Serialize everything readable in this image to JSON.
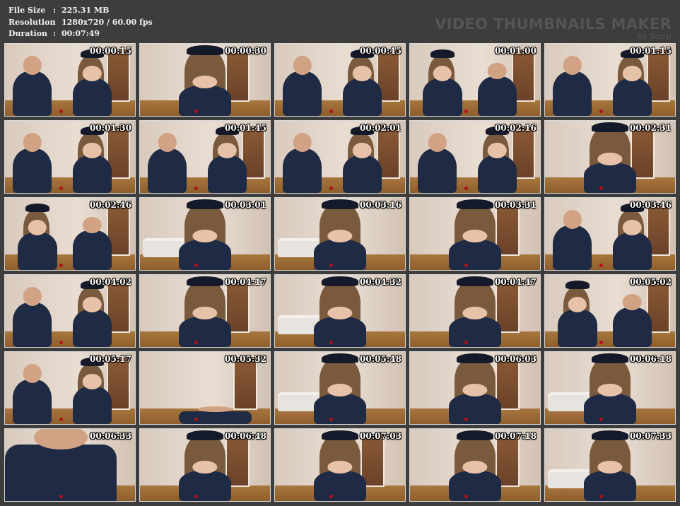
{
  "info": {
    "rows": [
      {
        "label": "File Size",
        "sep": ":",
        "value": "225.31 MB"
      },
      {
        "label": "Resolution",
        "sep": ":",
        "value": "1280x720 / 60.00 fps"
      },
      {
        "label": "Duration",
        "sep": ":",
        "value": "00:07:49"
      }
    ]
  },
  "watermark": {
    "title": "VIDEO THUMBNAILS MAKER",
    "sub": "by Scorp"
  },
  "thumbnails": [
    {
      "time": "00:00:15",
      "scene": "two"
    },
    {
      "time": "00:00:30",
      "scene": "woman-door"
    },
    {
      "time": "00:00:45",
      "scene": "two"
    },
    {
      "time": "00:01:00",
      "scene": "two-bend"
    },
    {
      "time": "00:01:15",
      "scene": "two"
    },
    {
      "time": "00:01:30",
      "scene": "two"
    },
    {
      "time": "00:01:45",
      "scene": "two"
    },
    {
      "time": "00:02:01",
      "scene": "two"
    },
    {
      "time": "00:02:16",
      "scene": "two"
    },
    {
      "time": "00:02:31",
      "scene": "woman-door"
    },
    {
      "time": "00:02:46",
      "scene": "two-bend"
    },
    {
      "time": "00:03:01",
      "scene": "woman-sofa"
    },
    {
      "time": "00:03:16",
      "scene": "woman-sofa"
    },
    {
      "time": "00:03:31",
      "scene": "woman-door"
    },
    {
      "time": "00:03:46",
      "scene": "two"
    },
    {
      "time": "00:04:02",
      "scene": "two"
    },
    {
      "time": "00:04:17",
      "scene": "woman-door"
    },
    {
      "time": "00:04:32",
      "scene": "woman-sofa"
    },
    {
      "time": "00:04:47",
      "scene": "woman-door"
    },
    {
      "time": "00:05:02",
      "scene": "two-bend"
    },
    {
      "time": "00:05:17",
      "scene": "two"
    },
    {
      "time": "00:05:32",
      "scene": "man-floor"
    },
    {
      "time": "00:05:48",
      "scene": "woman-sofa"
    },
    {
      "time": "00:06:03",
      "scene": "woman-door"
    },
    {
      "time": "00:06:18",
      "scene": "woman-sofa"
    },
    {
      "time": "00:06:33",
      "scene": "closeup"
    },
    {
      "time": "00:06:48",
      "scene": "woman-door"
    },
    {
      "time": "00:07:03",
      "scene": "woman-door"
    },
    {
      "time": "00:07:18",
      "scene": "woman-door"
    },
    {
      "time": "00:07:33",
      "scene": "woman-sofa"
    }
  ]
}
